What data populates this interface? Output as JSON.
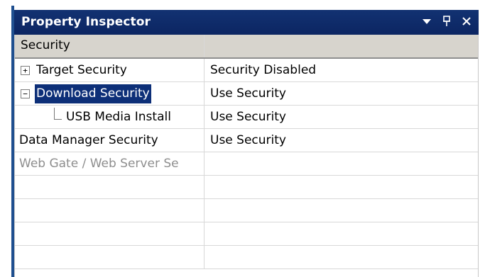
{
  "panel": {
    "title": "Property Inspector",
    "icons": [
      "dropdown-arrow-icon",
      "pin-icon",
      "close-icon"
    ]
  },
  "grid": {
    "header": {
      "col1": "Security",
      "col2": ""
    },
    "rows": [
      {
        "type": "collapsed",
        "name": "Target Security",
        "value": "Security Disabled",
        "expander": "+"
      },
      {
        "type": "expanded-selected",
        "name": "Download Security",
        "value": "Use Security",
        "expander": "−"
      },
      {
        "type": "child",
        "name": "USB Media Install",
        "value": "Use Security"
      },
      {
        "type": "plain",
        "name": "Data Manager Security",
        "value": "Use Security"
      },
      {
        "type": "disabled",
        "name": "Web Gate / Web Server Se",
        "value": ""
      }
    ],
    "empty_rows": 4
  },
  "colors": {
    "title_bar": "#123272",
    "selection": "#0d2f78",
    "header_bg": "#d7d4cd",
    "disabled_text": "#8e8e8e"
  }
}
